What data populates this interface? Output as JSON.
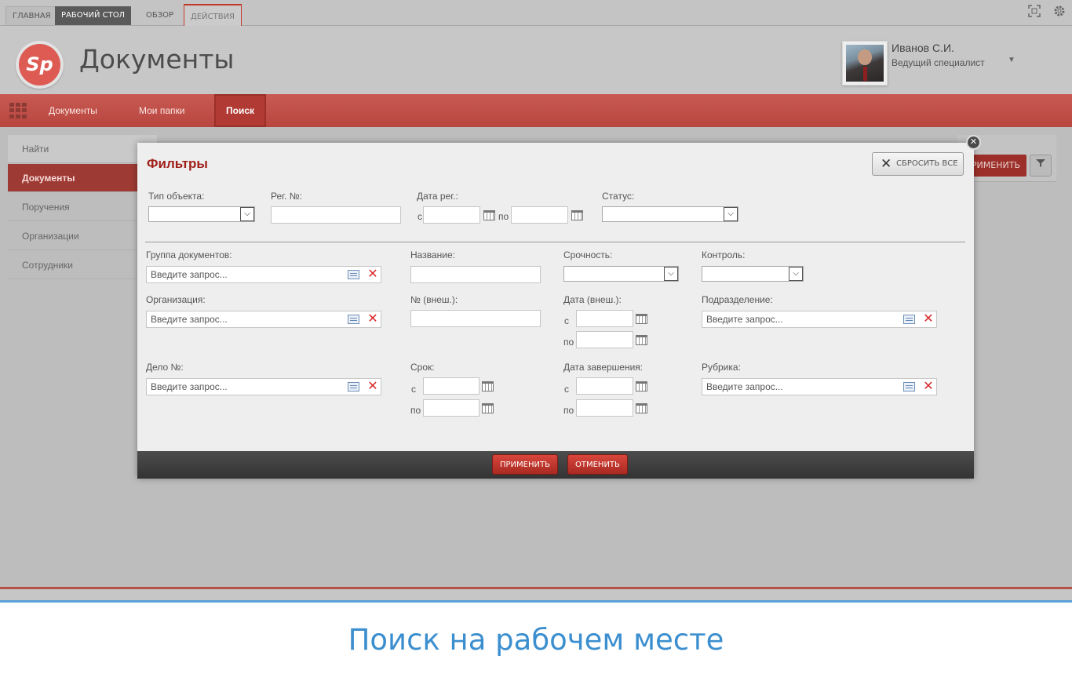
{
  "ribbon": {
    "tabs": [
      {
        "label": "ГЛАВНАЯ"
      },
      {
        "label": "РАБОЧИЙ СТОЛ"
      },
      {
        "label": "ОБЗОР"
      },
      {
        "label": "ДЕЙСТВИЯ"
      }
    ],
    "icons": [
      "fullscreen-icon",
      "gear-icon"
    ]
  },
  "header": {
    "logo_text": "Sp",
    "title": "Документы",
    "user": {
      "name": "Иванов С.И.",
      "role": "Ведущий специалист"
    }
  },
  "nav": {
    "items": [
      {
        "label": "Документы"
      },
      {
        "label": "Мои папки"
      },
      {
        "label": "Поиск"
      }
    ],
    "active": "Поиск"
  },
  "sidebar": {
    "items": [
      {
        "label": "Найти"
      },
      {
        "label": "Документы"
      },
      {
        "label": "Поручения"
      },
      {
        "label": "Организации"
      },
      {
        "label": "Сотрудники"
      }
    ],
    "active": "Документы"
  },
  "background": {
    "apply_label": "РИМЕНИТЬ"
  },
  "dialog": {
    "title": "Фильтры",
    "reset_label": "СБРОСИТЬ ВСЕ",
    "row1": {
      "object_type_label": "Тип объекта:",
      "reg_no_label": "Рег. №:",
      "reg_date_label": "Дата рег.:",
      "status_label": "Статус:"
    },
    "from": "с",
    "to": "по",
    "placeholder": "Введите запрос...",
    "doc_group_label": "Группа документов:",
    "name_label": "Название:",
    "urgency_label": "Срочность:",
    "control_label": "Контроль:",
    "organization_label": "Организация:",
    "ext_no_label": "№ (внеш.):",
    "ext_date_label": "Дата (внеш.):",
    "department_label": "Подразделение:",
    "case_no_label": "Дело №:",
    "deadline_label": "Срок:",
    "completion_date_label": "Дата завершения:",
    "rubric_label": "Рубрика:",
    "apply_label": "ПРИМЕНИТЬ",
    "cancel_label": "ОТМЕНИТЬ"
  },
  "caption": "Поиск на рабочем месте",
  "colors": {
    "accent_red": "#c0392b",
    "nav_red": "#c85a53",
    "caption_blue": "#3c8fcf",
    "title_red": "#a0201a"
  }
}
